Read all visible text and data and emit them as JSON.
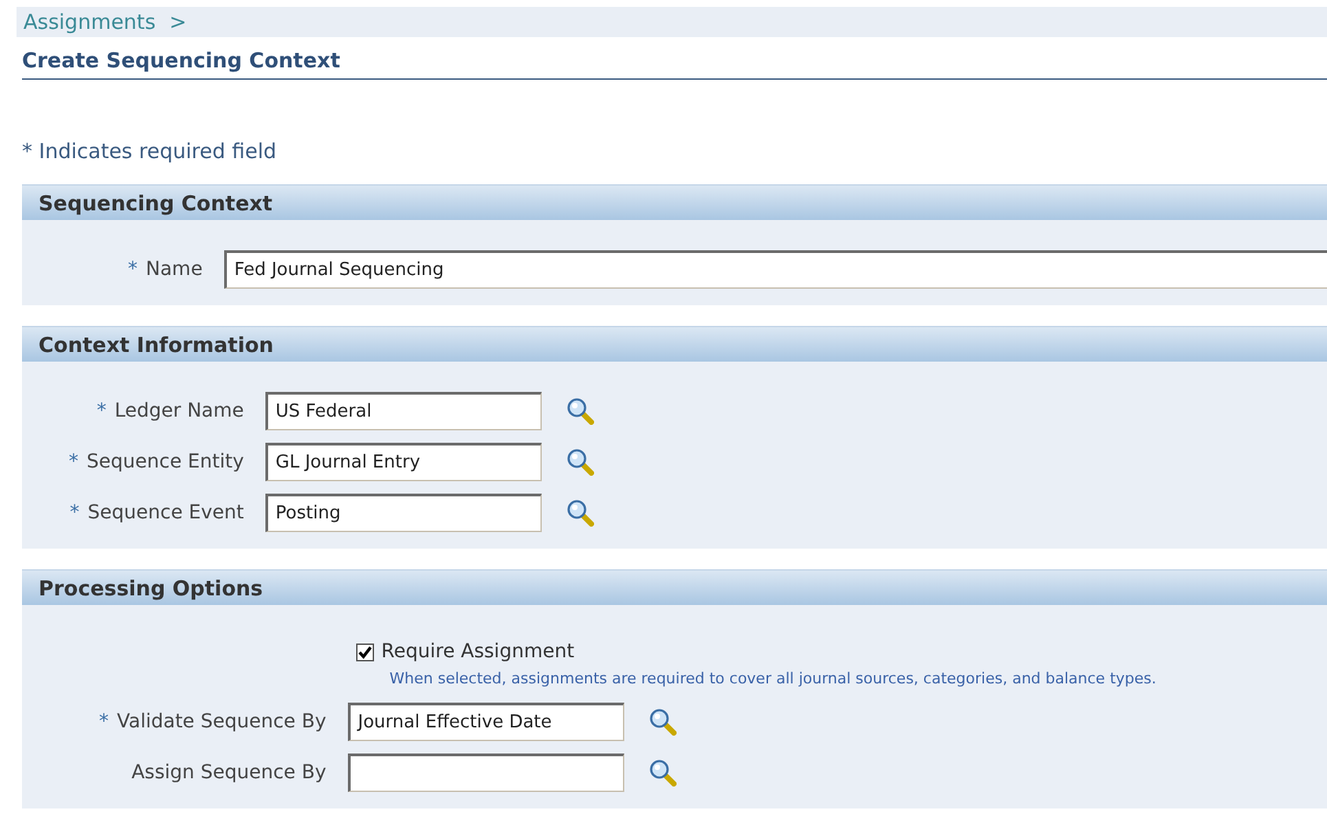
{
  "breadcrumb": [
    {
      "label": "Assignments",
      "separator": ">"
    }
  ],
  "page_title": "Create Sequencing Context",
  "required_note": "* Indicates required field",
  "sections": [
    {
      "title": "Sequencing Context",
      "items": [
        {
          "kind": "long-text",
          "marker": "*",
          "label": "Name",
          "value": "Fed Journal Sequencing"
        }
      ]
    },
    {
      "title": "Context Information",
      "items": [
        {
          "kind": "text",
          "marker": "*",
          "label": "Ledger Name",
          "value": "US Federal",
          "lookup": true
        },
        {
          "kind": "text",
          "marker": "*",
          "label": "Sequence Entity",
          "value": "GL Journal Entry",
          "lookup": true
        },
        {
          "kind": "text",
          "marker": "*",
          "label": "Sequence Event",
          "value": "Posting",
          "lookup": true
        }
      ]
    },
    {
      "title": "Processing Options",
      "items": [
        {
          "kind": "checkbox",
          "label": "Require Assignment",
          "checked": true,
          "hint": "When selected, assignments are required to cover all journal sources, categories, and balance types."
        },
        {
          "kind": "text",
          "marker": "*",
          "label": "Validate Sequence By",
          "value": "Journal Effective Date",
          "lookup": true
        },
        {
          "kind": "text",
          "label": "Assign Sequence By",
          "lookup": true
        }
      ]
    }
  ]
}
